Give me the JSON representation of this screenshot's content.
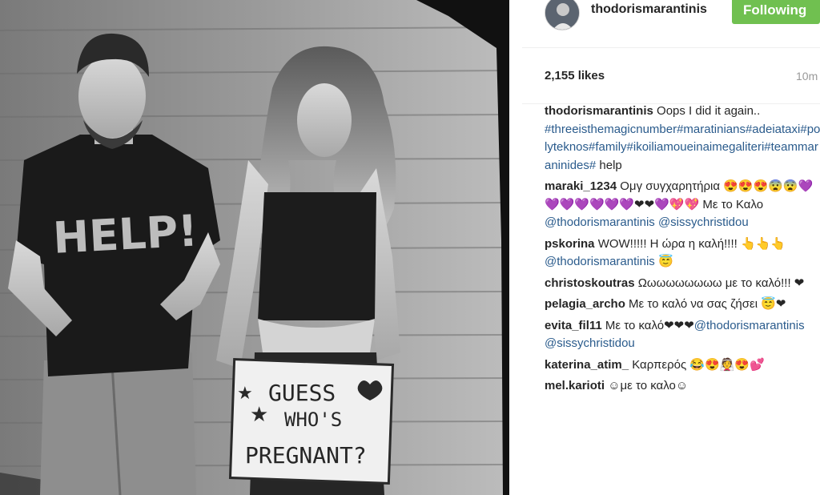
{
  "post": {
    "image_alt": "Black and white photo of a man in a HELP! t-shirt and a pregnant woman holding a sign",
    "shirt_text": "HELP!",
    "sign_line1": "GUESS",
    "sign_line2": "WHO'S",
    "sign_line3": "PREGNANT?"
  },
  "header": {
    "username": "thodorismarantinis",
    "follow_label": "Following"
  },
  "stats": {
    "likes": "2,155 likes",
    "time": "10m"
  },
  "caption": {
    "user": "thodorismarantinis",
    "text": " Oops I did it again.. ",
    "hashtags": "#threeisthemagicnumber#maratinians#adeiataxi#polyteknos#family#ikoiliamoueinaimegaliteri#teammaraninides#",
    "tail": " help"
  },
  "comments": [
    {
      "user": "maraki_1234",
      "text": " Ομγ συγχαρητήρια 😍😍😍😨😨💜💜💜💜💜💜💜❤❤💜💖💖 Με το Καλο ",
      "mention": "@thodorismarantinis @sissychristidou",
      "tail": ""
    },
    {
      "user": "pskorina",
      "text": " WOW!!!!! Η ώρα η καλή!!!! 👆👆👆 ",
      "mention": "@thodorismarantinis",
      "tail": " 😇"
    },
    {
      "user": "christoskoutras",
      "text": " Ωωωωωωωωω με το καλό!!! ❤",
      "mention": "",
      "tail": ""
    },
    {
      "user": "pelagia_archo",
      "text": " Με το καλό να σας ζήσει 😇❤",
      "mention": "",
      "tail": ""
    },
    {
      "user": "evita_fil11",
      "text": " Με το καλό❤❤❤",
      "mention": "@thodorismarantinis @sissychristidou",
      "tail": ""
    },
    {
      "user": "katerina_atim_",
      "text": " Καρπερός 😂😍👰😍💕",
      "mention": "",
      "tail": ""
    },
    {
      "user": "mel.karioti",
      "text": " ☺με το καλο☺",
      "mention": "",
      "tail": ""
    }
  ],
  "colors": {
    "follow_bg": "#70c050",
    "link": "#2a5b8c",
    "muted": "#999999"
  },
  "icons": {
    "avatar": "profile-avatar"
  }
}
